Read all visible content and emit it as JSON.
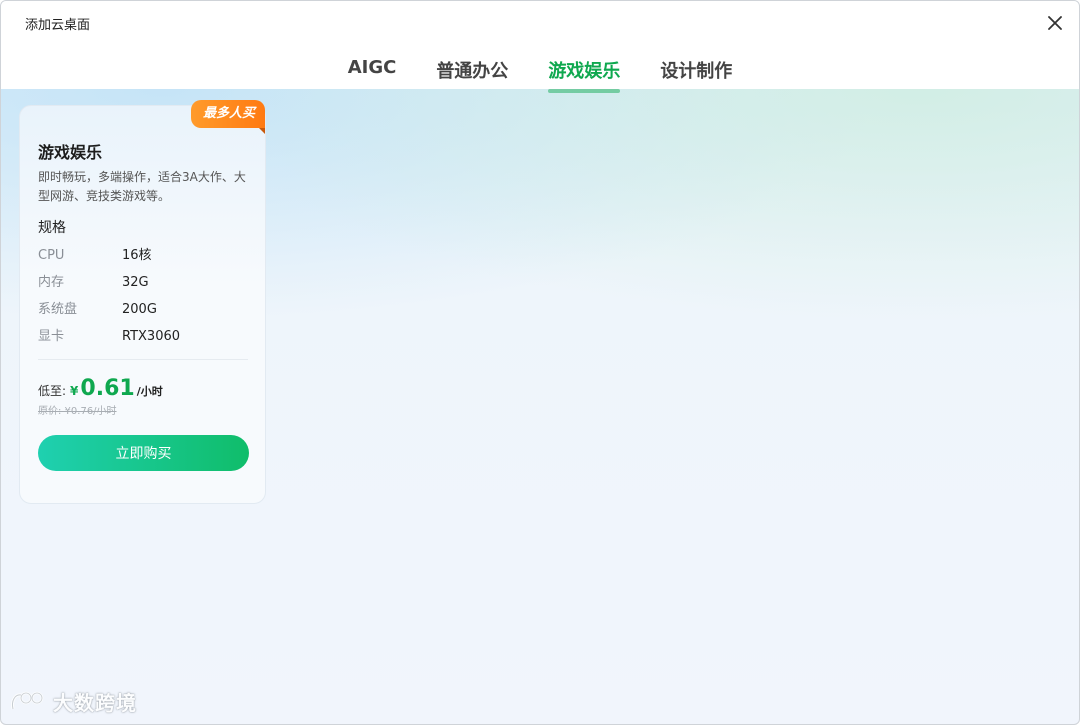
{
  "window": {
    "title": "添加云桌面"
  },
  "tabs": [
    {
      "label": "AIGC"
    },
    {
      "label": "普通办公"
    },
    {
      "label": "游戏娱乐"
    },
    {
      "label": "设计制作"
    }
  ],
  "active_tab": "游戏娱乐",
  "card": {
    "badge": "最多人买",
    "title": "游戏娱乐",
    "description": "即时畅玩，多端操作，适合3A大作、大型网游、竞技类游戏等。",
    "spec_title": "规格",
    "specs": [
      {
        "label": "CPU",
        "value": "16核"
      },
      {
        "label": "内存",
        "value": "32G"
      },
      {
        "label": "系统盘",
        "value": "200G"
      },
      {
        "label": "显卡",
        "value": "RTX3060"
      }
    ],
    "price_prefix": "低至:",
    "price_currency": "¥",
    "price_value": "0.61",
    "price_unit": "/小时",
    "original_price": "原价: ¥0.76/小时",
    "buy_label": "立即购买"
  },
  "watermark": {
    "text": "大数跨境"
  },
  "colors": {
    "accent": "#0fa84f",
    "badge": "#ff8a1f",
    "button_start": "#1fd0b0",
    "button_end": "#10bd6a"
  },
  "icons": {
    "close": "close-icon",
    "watermark_logo": "logo-icon"
  }
}
